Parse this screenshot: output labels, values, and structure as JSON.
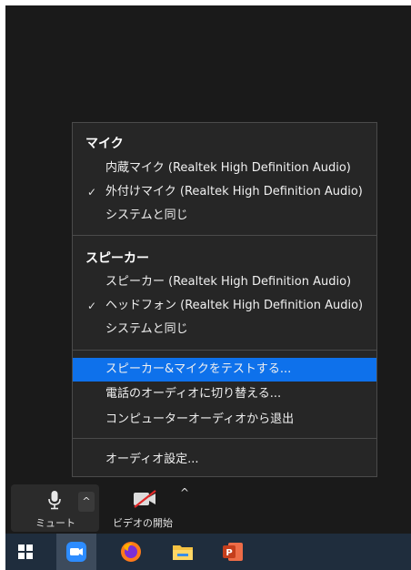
{
  "menu": {
    "mic_title": "マイク",
    "mic_items": [
      {
        "label": "内蔵マイク (Realtek High Definition Audio)",
        "checked": false
      },
      {
        "label": "外付けマイク (Realtek High Definition Audio)",
        "checked": true
      },
      {
        "label": "システムと同じ",
        "checked": false
      }
    ],
    "speaker_title": "スピーカー",
    "speaker_items": [
      {
        "label": "スピーカー (Realtek High Definition Audio)",
        "checked": false
      },
      {
        "label": "ヘッドフォン (Realtek High Definition Audio)",
        "checked": true
      },
      {
        "label": "システムと同じ",
        "checked": false
      }
    ],
    "actions": [
      {
        "label": "スピーカー&マイクをテストする..."
      },
      {
        "label": "電話のオーディオに切り替える..."
      },
      {
        "label": "コンピューターオーディオから退出"
      }
    ],
    "settings_label": "オーディオ設定...",
    "check_glyph": "✓"
  },
  "toolbar": {
    "mute_label": "ミュート",
    "video_label": "ビデオの開始",
    "caret_glyph": "^"
  },
  "taskbar": {
    "icons": [
      "windows-start-icon",
      "zoom-app-icon",
      "firefox-icon",
      "file-explorer-icon",
      "powerpoint-icon"
    ]
  },
  "colors": {
    "highlight": "#0e71eb",
    "menu_bg": "#262626",
    "taskbar_bg": "#1f2d3d"
  }
}
